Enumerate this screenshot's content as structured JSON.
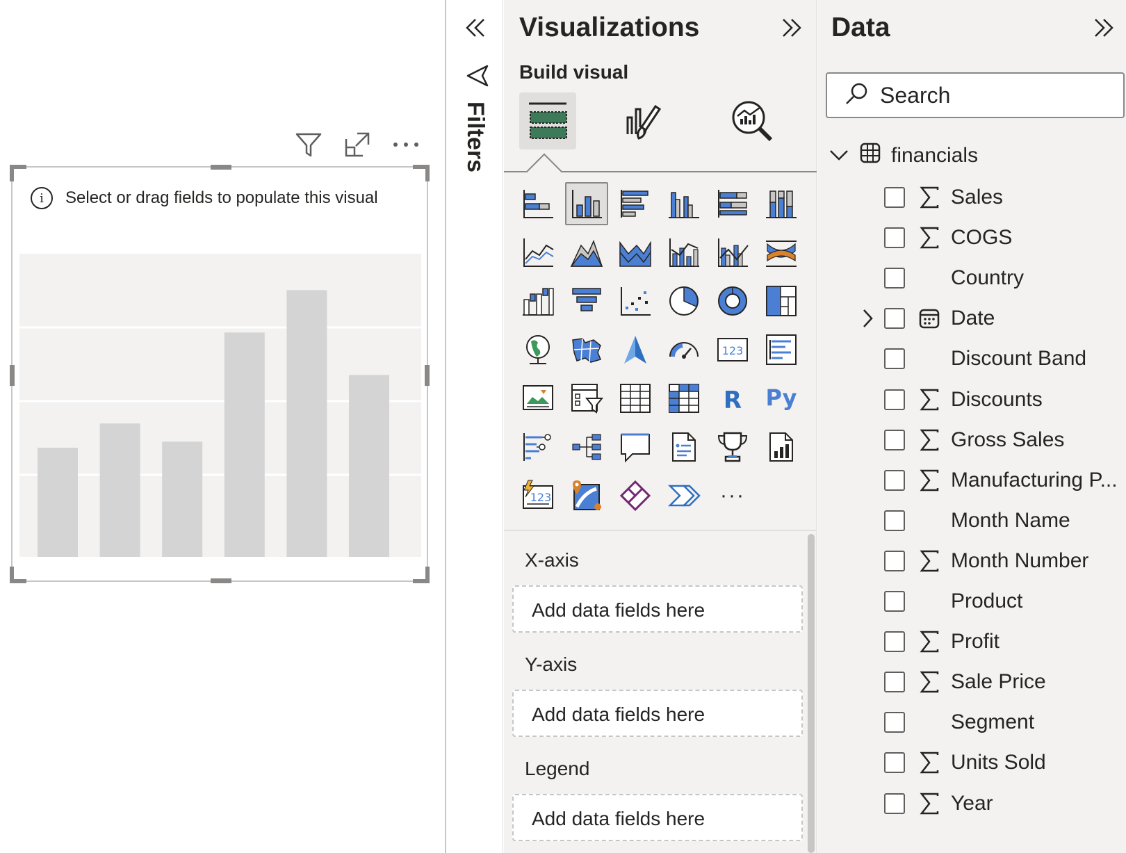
{
  "canvas": {
    "visual_message": "Select or drag fields to populate this visual",
    "placeholder_bars": [
      0.36,
      0.44,
      0.38,
      0.74,
      0.88,
      0.6
    ]
  },
  "filters": {
    "label": "Filters"
  },
  "visualizations": {
    "title": "Visualizations",
    "build_label": "Build visual",
    "tabs": [
      "build-visual-icon",
      "format-visual-icon",
      "analytics-icon"
    ],
    "more_label": "···",
    "wells": [
      {
        "label": "X-axis",
        "placeholder": "Add data fields here"
      },
      {
        "label": "Y-axis",
        "placeholder": "Add data fields here"
      },
      {
        "label": "Legend",
        "placeholder": "Add data fields here"
      }
    ]
  },
  "data": {
    "title": "Data",
    "search_placeholder": "Search",
    "table_name": "financials",
    "fields": [
      {
        "name": "Sales",
        "icon": "sigma"
      },
      {
        "name": "COGS",
        "icon": "sigma"
      },
      {
        "name": "Country",
        "icon": ""
      },
      {
        "name": "Date",
        "icon": "calendar",
        "expandable": true
      },
      {
        "name": "Discount Band",
        "icon": ""
      },
      {
        "name": "Discounts",
        "icon": "sigma"
      },
      {
        "name": "Gross Sales",
        "icon": "sigma"
      },
      {
        "name": "Manufacturing P...",
        "icon": "sigma"
      },
      {
        "name": "Month Name",
        "icon": ""
      },
      {
        "name": "Month Number",
        "icon": "sigma"
      },
      {
        "name": "Product",
        "icon": ""
      },
      {
        "name": "Profit",
        "icon": "sigma"
      },
      {
        "name": "Sale Price",
        "icon": "sigma"
      },
      {
        "name": "Segment",
        "icon": ""
      },
      {
        "name": "Units Sold",
        "icon": "sigma"
      },
      {
        "name": "Year",
        "icon": "sigma"
      }
    ]
  },
  "colors": {
    "accent_blue": "#4a7fd4",
    "panel_bg": "#f3f2f1",
    "placeholder_bar": "#d4d4d4"
  }
}
